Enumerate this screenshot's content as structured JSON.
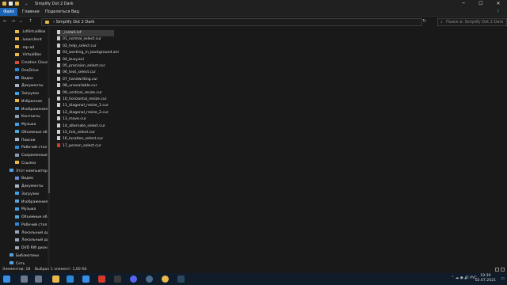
{
  "window": {
    "title": "Simplify Dot 2 Dark",
    "minimize": "─",
    "maximize": "☐",
    "close": "✕"
  },
  "ribbon": {
    "file": "Файл",
    "tabs": [
      "Главная",
      "Поделиться",
      "Вид"
    ]
  },
  "address": {
    "path": "› Simplify Dot 2 Dark",
    "search_placeholder": "Поиск в: Simplify Dot 2 Dark"
  },
  "nav_items": [
    {
      "label": ".LdVirtualBox",
      "icon": "folder-icon",
      "color": "#e8b84a"
    },
    {
      "label": ".lunarclient",
      "icon": "folder-icon",
      "color": "#e8b84a"
    },
    {
      "label": ".mp-ad",
      "icon": "folder-icon",
      "color": "#e8b84a"
    },
    {
      "label": ".VirtualBox",
      "icon": "folder-icon",
      "color": "#e8b84a"
    },
    {
      "label": "Creative Cloud",
      "icon": "cloud-icon",
      "color": "#d94c3d"
    },
    {
      "label": "OneDrive",
      "icon": "cloud-icon",
      "color": "#2b88d8"
    },
    {
      "label": "Видео",
      "icon": "video-icon",
      "color": "#6a8bd6"
    },
    {
      "label": "Документы",
      "icon": "document-icon",
      "color": "#aab4c8"
    },
    {
      "label": "Загрузки",
      "icon": "download-icon",
      "color": "#3ea0e6"
    },
    {
      "label": "Избранное",
      "icon": "star-icon",
      "color": "#e8b84a"
    },
    {
      "label": "Изображения",
      "icon": "image-icon",
      "color": "#5aa0d8"
    },
    {
      "label": "Контакты",
      "icon": "contacts-icon",
      "color": "#8a9bb4"
    },
    {
      "label": "Музыка",
      "icon": "music-icon",
      "color": "#3ea0e6"
    },
    {
      "label": "Объемные об",
      "icon": "3d-objects-icon",
      "color": "#4aa8d8"
    },
    {
      "label": "Поиски",
      "icon": "search-icon",
      "color": "#aab4c8"
    },
    {
      "label": "Рабочий стол",
      "icon": "desktop-icon",
      "color": "#2b88d8"
    },
    {
      "label": "Сохраненные",
      "icon": "saved-games-icon",
      "color": "#8a9bb4"
    },
    {
      "label": "Ссылки",
      "icon": "links-icon",
      "color": "#e8b84a"
    },
    {
      "label": "Этот компьютер",
      "icon": "computer-icon",
      "color": "#5aa0d8"
    },
    {
      "label": "Видео",
      "icon": "video-icon",
      "color": "#6a8bd6"
    },
    {
      "label": "Документы",
      "icon": "document-icon",
      "color": "#aab4c8"
    },
    {
      "label": "Загрузки",
      "icon": "download-icon",
      "color": "#3ea0e6"
    },
    {
      "label": "Изображения",
      "icon": "image-icon",
      "color": "#5aa0d8"
    },
    {
      "label": "Музыка",
      "icon": "music-icon",
      "color": "#3ea0e6"
    },
    {
      "label": "Объемные об",
      "icon": "3d-objects-icon",
      "color": "#4aa8d8"
    },
    {
      "label": "Рабочий стол",
      "icon": "desktop-icon",
      "color": "#2b88d8"
    },
    {
      "label": "Локальный ди",
      "icon": "drive-icon",
      "color": "#9aa4b0"
    },
    {
      "label": "Локальный ди",
      "icon": "drive-icon",
      "color": "#9aa4b0"
    },
    {
      "label": "DVD RW диско",
      "icon": "dvd-icon",
      "color": "#9aa4b0"
    },
    {
      "label": "Библиотеки",
      "icon": "library-icon",
      "color": "#5aa0d8"
    },
    {
      "label": "Сеть",
      "icon": "network-icon",
      "color": "#5aa0d8"
    }
  ],
  "files": [
    "_install.inf",
    "01_normal_select.cur",
    "02_help_select.cur",
    "03_working_in_background.ani",
    "04_busy.ani",
    "05_precision_select.cur",
    "06_text_select.cur",
    "07_handwriting.cur",
    "08_unavailable.cur",
    "09_vertical_resize.cur",
    "10_horizontal_resize.cur",
    "11_diagonal_resize_1.cur",
    "12_diagonal_resize_2.cur",
    "13_move.cur",
    "14_alternate_select.cur",
    "15_link_select.cur",
    "16_location_select.cur",
    "17_person_select.cur"
  ],
  "status": {
    "count": "Элементов: 18",
    "selection": "Выбран 1 элемент: 1,60 КБ"
  },
  "taskbar": {
    "apps": [
      {
        "icon": "start-icon",
        "color": "#3a8ee6"
      },
      {
        "icon": "search-icon",
        "color": "#6a7a8c"
      },
      {
        "icon": "task-view-icon",
        "color": "#6a7a8c"
      },
      {
        "icon": "explorer-icon",
        "color": "#e8b84a"
      },
      {
        "icon": "store-icon",
        "color": "#2b88d8"
      },
      {
        "icon": "mail-icon",
        "color": "#3a8ee6"
      },
      {
        "icon": "app-red-icon",
        "color": "#d23a2a"
      },
      {
        "icon": "app-dark-icon",
        "color": "#3a3a3a"
      },
      {
        "icon": "discord-icon",
        "color": "#5865f2"
      },
      {
        "icon": "app-globe-icon",
        "color": "#4a6a8a"
      },
      {
        "icon": "chrome-icon",
        "color": "#e8b84a"
      },
      {
        "icon": "steam-icon",
        "color": "#2a475e"
      }
    ],
    "lang": "РУС",
    "time": "19:39",
    "date": "02.07.2021"
  }
}
